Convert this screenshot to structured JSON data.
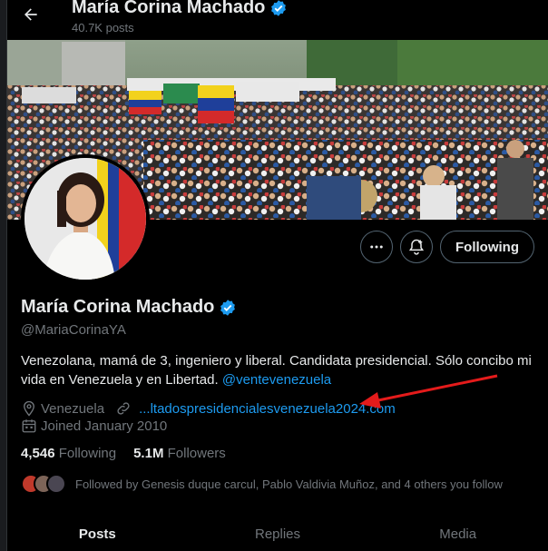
{
  "header": {
    "title": "María Corina Machado",
    "post_count": "40.7K posts"
  },
  "profile": {
    "display_name": "María Corina Machado",
    "handle": "@MariaCorinaYA",
    "bio_text": "Venezolana, mamá de 3, ingeniero y liberal. Candidata presidencial. Sólo concibo mi vida en Venezuela y en Libertad.",
    "bio_mention": "@ventevenezuela",
    "location": "Venezuela",
    "website": "...ltadospresidencialesvenezuela2024.com",
    "joined": "Joined January 2010",
    "following_count": "4,546",
    "following_label": "Following",
    "followers_count": "5.1M",
    "followers_label": "Followers",
    "followed_by": "Followed by Genesis duque carcul, Pablo Valdivia Muñoz, and 4 others you follow"
  },
  "actions": {
    "following_label": "Following"
  },
  "tabs": [
    {
      "label": "Posts",
      "active": true
    },
    {
      "label": "Replies",
      "active": false
    },
    {
      "label": "Media",
      "active": false
    }
  ],
  "colors": {
    "accent": "#1d9bf0",
    "annotation": "#e41b1b"
  },
  "icons": {
    "back": "arrow-left-icon",
    "verified": "verified-badge-icon",
    "more": "more-dots-icon",
    "notify": "bell-plus-icon",
    "location": "location-pin-icon",
    "link": "link-icon",
    "calendar": "calendar-icon"
  }
}
